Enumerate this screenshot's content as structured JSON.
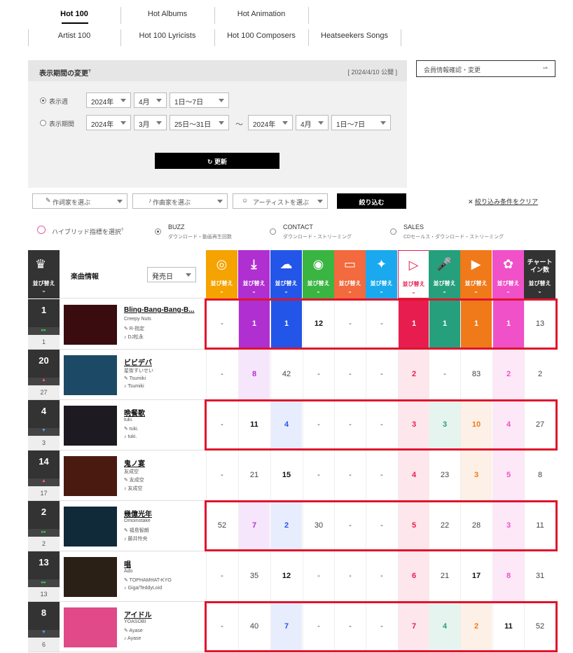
{
  "tabs_row1": [
    "Hot 100",
    "Hot Albums",
    "Hot Animation"
  ],
  "tabs_row2": [
    "Artist 100",
    "Hot 100 Lyricists",
    "Hot 100 Composers",
    "Heatseekers Songs"
  ],
  "period": {
    "title": "表示期間の変更",
    "published": "[ 2024/4/10 公開 ]",
    "member_btn": "会員情報確認・変更",
    "week_label": "表示週",
    "range_label": "表示期間",
    "week": {
      "year": "2024年",
      "month": "4月",
      "days": "1日〜7日"
    },
    "from": {
      "year": "2024年",
      "month": "3月",
      "days": "25日〜31日"
    },
    "tilde": "〜",
    "to": {
      "year": "2024年",
      "month": "4月",
      "days": "1日〜7日"
    },
    "update": "更新"
  },
  "filters": {
    "lyricist": "作詞家を選ぶ",
    "composer": "作曲家を選ぶ",
    "artist": "アーティストを選ぶ",
    "apply": "絞り込む",
    "clear": "絞り込み条件をクリア"
  },
  "hybrid": {
    "label": "ハイブリッド指標を選択",
    "options": [
      {
        "name": "BUZZ",
        "desc": "ダウンロード・動画再生回数",
        "on": true
      },
      {
        "name": "CONTACT",
        "desc": "ダウンロード・ストリーミング",
        "on": false
      },
      {
        "name": "SALES",
        "desc": "CDセールス・ダウンロード・ストリーミング",
        "on": false
      }
    ]
  },
  "table_header": {
    "song_info": "楽曲情報",
    "release_sort": "発売日",
    "sort_label": "並び替え",
    "chart_in": "チャートイン数",
    "columns": [
      {
        "icon": "cd-icon",
        "color": "#f5a300"
      },
      {
        "icon": "download-icon",
        "color": "#b02fd0"
      },
      {
        "icon": "cloud-stream-icon",
        "color": "#2355e8"
      },
      {
        "icon": "radio-icon",
        "color": "#3ab542"
      },
      {
        "icon": "pc-icon",
        "color": "#f26a3d"
      },
      {
        "icon": "twitter-icon",
        "color": "#1aa9ee"
      },
      {
        "icon": "video-icon",
        "color": "#e81d4f"
      },
      {
        "icon": "karaoke-icon",
        "color": "#26a07c"
      },
      {
        "icon": "playlist-icon",
        "color": "#f07a1a"
      },
      {
        "icon": "hybrid-icon",
        "color": "#f050c8"
      }
    ]
  },
  "rows": [
    {
      "rank": "1",
      "prev": "1",
      "move": "▸▸",
      "title": "Bling-Bang-Bang-B...",
      "artist": "Creepy Nuts",
      "lyricist": "R-指定",
      "composer": "DJ松永",
      "values": [
        "-",
        "1",
        "1",
        "12",
        "-",
        "-",
        "1",
        "1",
        "1",
        "1"
      ],
      "chart_in": "13",
      "highlight": true
    },
    {
      "rank": "20",
      "prev": "27",
      "move": "▲",
      "title": "ビビデバ",
      "artist": "星街すいせい",
      "lyricist": "Tsumiki",
      "composer": "Tsumiki",
      "values": [
        "-",
        "8",
        "42",
        "-",
        "-",
        "-",
        "2",
        "-",
        "83",
        "2"
      ],
      "chart_in": "2",
      "highlight": false
    },
    {
      "rank": "4",
      "prev": "3",
      "move": "▼",
      "title": "晩餐歌",
      "artist": "tuki.",
      "lyricist": "tuki.",
      "composer": "tuki.",
      "values": [
        "-",
        "11",
        "4",
        "-",
        "-",
        "-",
        "3",
        "3",
        "10",
        "4"
      ],
      "chart_in": "27",
      "highlight": true
    },
    {
      "rank": "14",
      "prev": "17",
      "move": "▲",
      "title": "鬼ノ宴",
      "artist": "友成空",
      "lyricist": "友成空",
      "composer": "友成空",
      "values": [
        "-",
        "21",
        "15",
        "-",
        "-",
        "-",
        "4",
        "23",
        "3",
        "5"
      ],
      "chart_in": "8",
      "highlight": false
    },
    {
      "rank": "2",
      "prev": "2",
      "move": "▸▸",
      "title": "幾億光年",
      "artist": "Omoinotake",
      "lyricist": "福島智朗",
      "composer": "藤井怜央",
      "values": [
        "52",
        "7",
        "2",
        "30",
        "-",
        "-",
        "5",
        "22",
        "28",
        "3"
      ],
      "chart_in": "11",
      "highlight": true
    },
    {
      "rank": "13",
      "prev": "13",
      "move": "▸▸",
      "title": "唱",
      "artist": "Ado",
      "lyricist": "TOPHAMHAT-KYO",
      "composer": "Giga/TeddyLoid",
      "values": [
        "-",
        "35",
        "12",
        "-",
        "-",
        "-",
        "6",
        "21",
        "17",
        "8"
      ],
      "chart_in": "31",
      "highlight": false
    },
    {
      "rank": "8",
      "prev": "6",
      "move": "▼",
      "title": "アイドル",
      "artist": "YOASOBI",
      "lyricist": "Ayase",
      "composer": "Ayase",
      "values": [
        "-",
        "40",
        "7",
        "-",
        "-",
        "-",
        "7",
        "4",
        "2",
        "11"
      ],
      "chart_in": "52",
      "highlight": true
    }
  ]
}
